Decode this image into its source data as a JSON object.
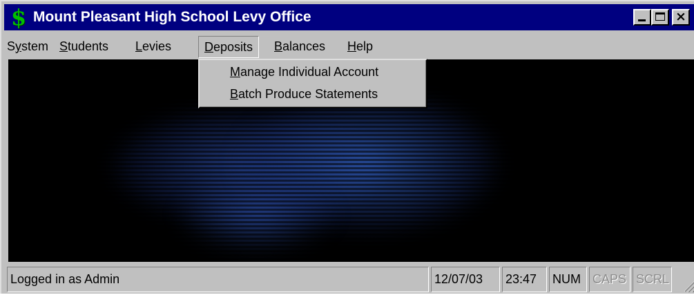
{
  "window": {
    "title": "Mount Pleasant High School Levy Office",
    "icon": "dollar-icon",
    "accent_color": "#000080"
  },
  "menubar": {
    "items": [
      {
        "label": "System",
        "key": "y"
      },
      {
        "label": "Students",
        "key": "S"
      },
      {
        "label": "Levies",
        "key": "L"
      },
      {
        "label": "Deposits",
        "key": "D",
        "active": true
      },
      {
        "label": "Balances",
        "key": "B"
      },
      {
        "label": "Help",
        "key": "H"
      }
    ]
  },
  "deposits_menu": {
    "items": [
      {
        "label": "Manage Individual Account",
        "key": "M"
      },
      {
        "label": "Batch Produce Statements",
        "key": "B"
      }
    ]
  },
  "statusbar": {
    "message": "Logged in as Admin",
    "date": "12/07/03",
    "time": "23:47",
    "num": "NUM",
    "caps": "CAPS",
    "scrl": "SCRL"
  }
}
